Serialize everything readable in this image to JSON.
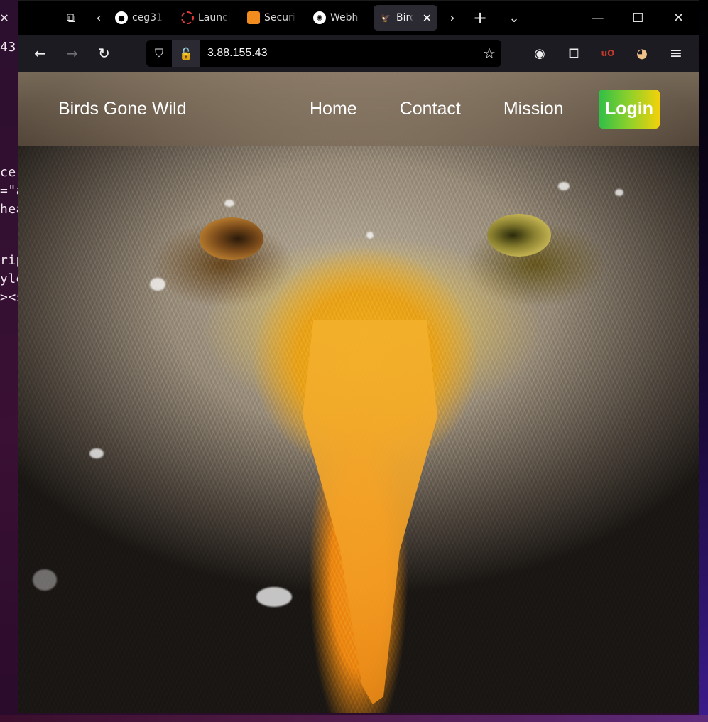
{
  "terminal": {
    "close_glyph": "✕",
    "lines": [
      "43",
      "ce-",
      "=\"a",
      "hea",
      "rip",
      "yle",
      "><s"
    ]
  },
  "browser": {
    "tabs": [
      {
        "title": "ceg31",
        "favicon": "github-icon"
      },
      {
        "title": "Launch",
        "favicon": "launch-icon"
      },
      {
        "title": "Securi",
        "favicon": "aws-icon"
      },
      {
        "title": "Webh",
        "favicon": "openai-icon"
      },
      {
        "title": "Birds",
        "favicon": "bird-icon",
        "active": true
      }
    ],
    "url": "3.88.155.43",
    "glyphs": {
      "tab_overview": "⧉",
      "scroll_left": "‹",
      "scroll_right": "›",
      "new_tab": "+",
      "list_all": "⌄",
      "minimize": "—",
      "maximize": "☐",
      "close": "✕",
      "tab_close": "✕",
      "back": "←",
      "forward": "→",
      "reload": "↻",
      "shield": "⛉",
      "insecure": "🔓",
      "star": "☆",
      "account": "◉",
      "extensions": "⧠",
      "ublock": "uO",
      "profile": "◕",
      "menu": "≡"
    }
  },
  "site": {
    "brand": "Birds Gone Wild",
    "nav": [
      "Home",
      "Contact",
      "Mission"
    ],
    "login": "Login",
    "login_gradient": [
      "#2fbf48",
      "#f2d10a"
    ]
  }
}
